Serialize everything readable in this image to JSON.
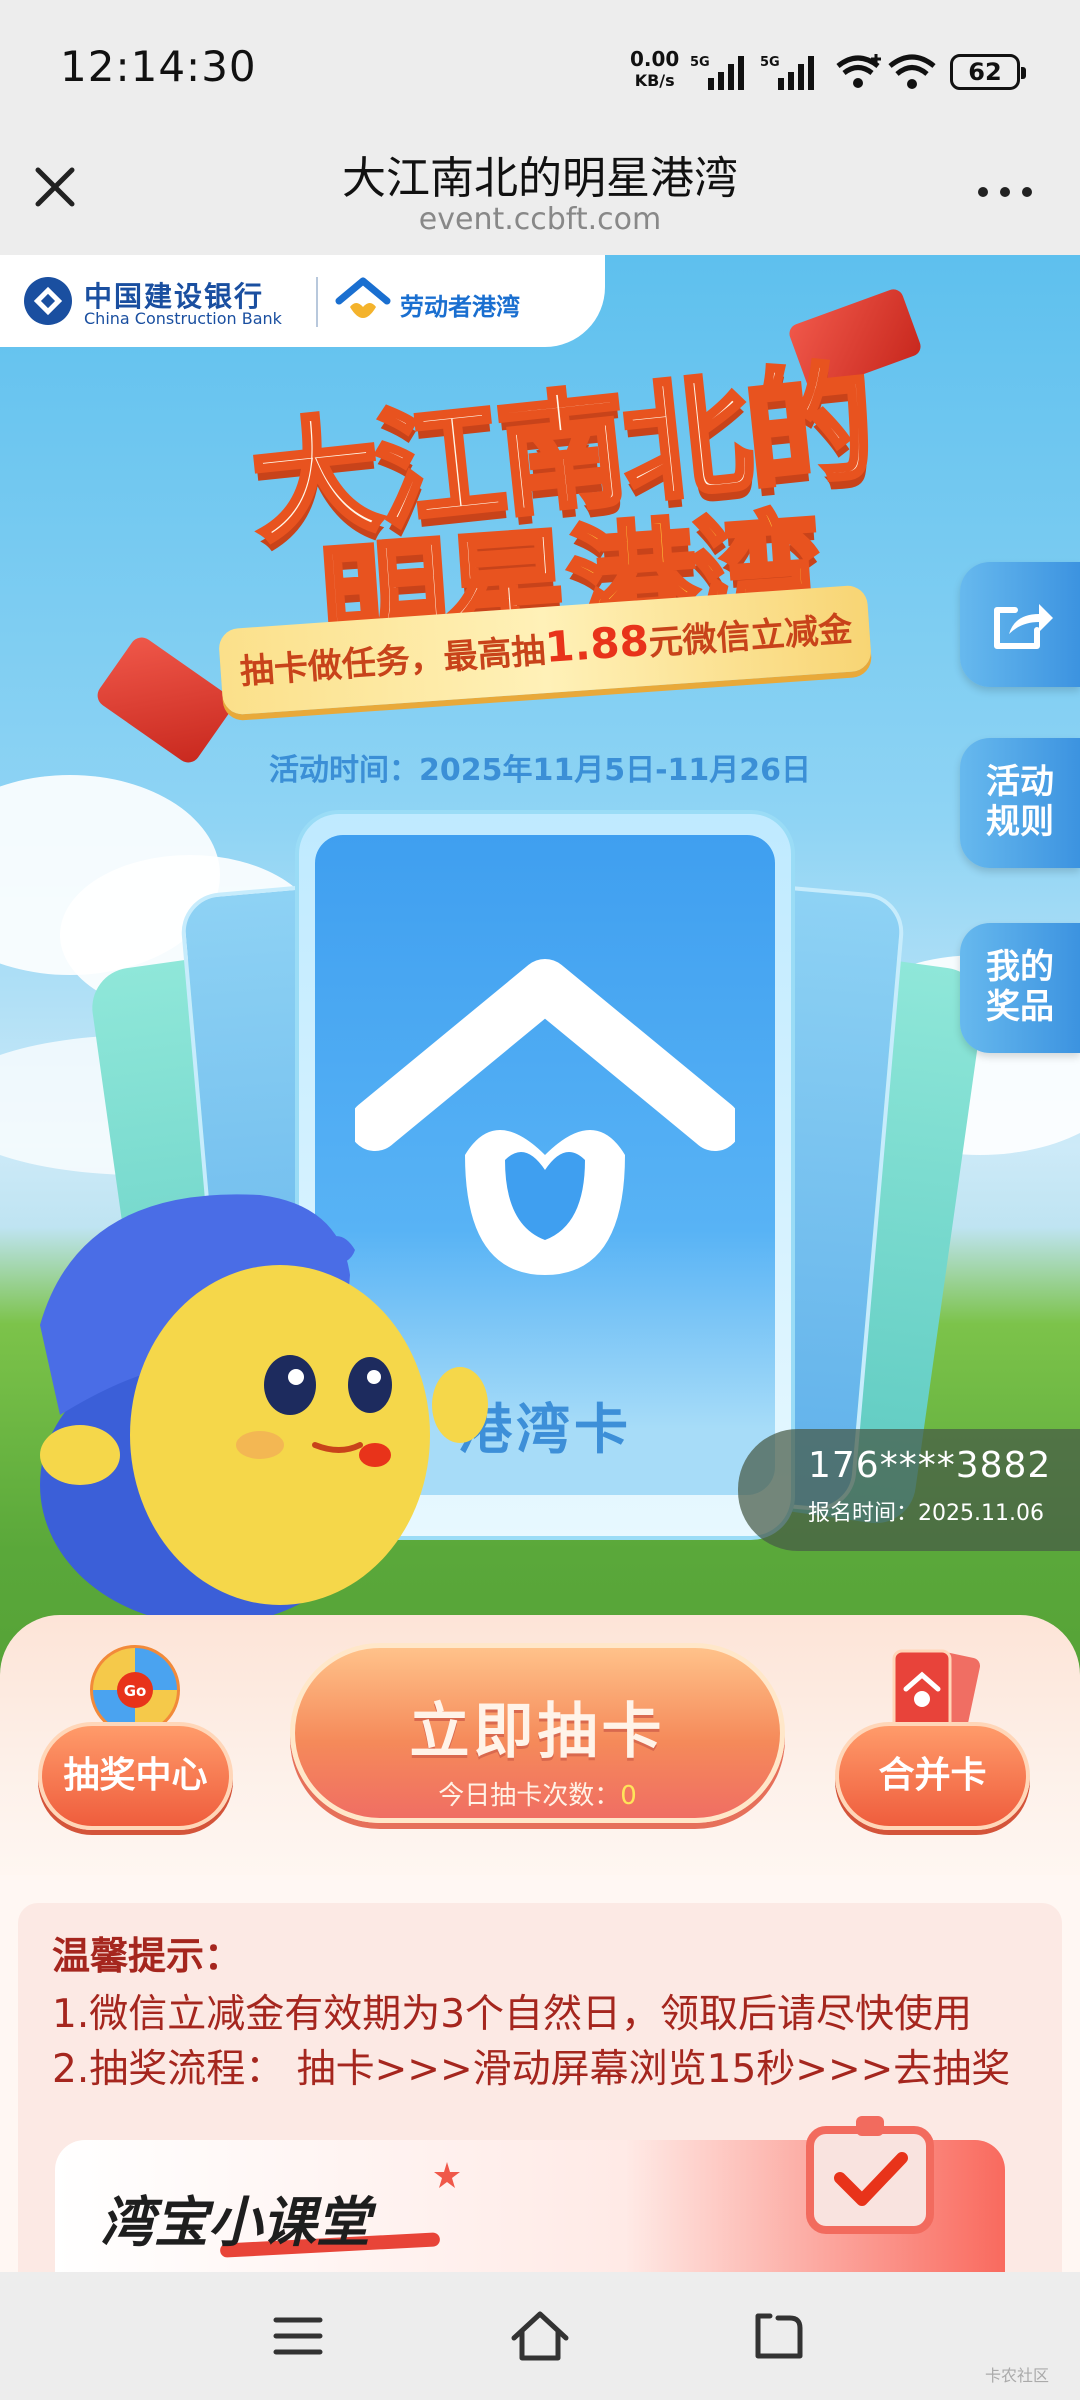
{
  "status_bar": {
    "time": "12:14:30",
    "net_speed_value": "0.00",
    "net_speed_unit": "KB/s",
    "signal_1_label": "5G",
    "signal_2_label": "5G",
    "battery": "62"
  },
  "title_bar": {
    "title": "大江南北的明星港湾",
    "url": "event.ccbft.com"
  },
  "brand": {
    "bank_name": "中国建设银行",
    "bank_name_en": "China Construction Bank",
    "partner_name": "劳动者港湾"
  },
  "hero": {
    "title_line1": "大江南北的",
    "title_line2_a": "明星",
    "title_line2_b": "港湾",
    "ribbon_prefix": "抽卡做任务，最高抽",
    "ribbon_amount": "1.88",
    "ribbon_suffix": "元微信立减金",
    "event_time": "活动时间：2025年11月5日-11月26日",
    "card_name": "港湾卡"
  },
  "side_tabs": {
    "rules": "活动\n规则",
    "prizes": "我的\n奖品"
  },
  "user": {
    "phone": "176****3882",
    "signup_date": "报名时间：2025.11.06"
  },
  "actions": {
    "lottery_center": "抽奖中心",
    "wheel_label": "Go",
    "draw_button": "立即抽卡",
    "draw_count_label": "今日抽卡次数：",
    "draw_count_value": "0",
    "merge_cards": "合并卡"
  },
  "tips": {
    "title": "温馨提示：",
    "items": [
      "1.微信立减金有效期为3个自然日，领取后请尽快使用",
      "2.抽奖流程：  抽卡>>>滑动屏幕浏览15秒>>>去抽奖"
    ]
  },
  "classroom": {
    "title": "湾宝小课堂"
  },
  "watermark": "卡农社区",
  "colors": {
    "accent_red": "#a5261e",
    "button_orange": "#f58a5a",
    "sky_blue": "#5ec0ee",
    "card_blue": "#3f9ff0"
  }
}
